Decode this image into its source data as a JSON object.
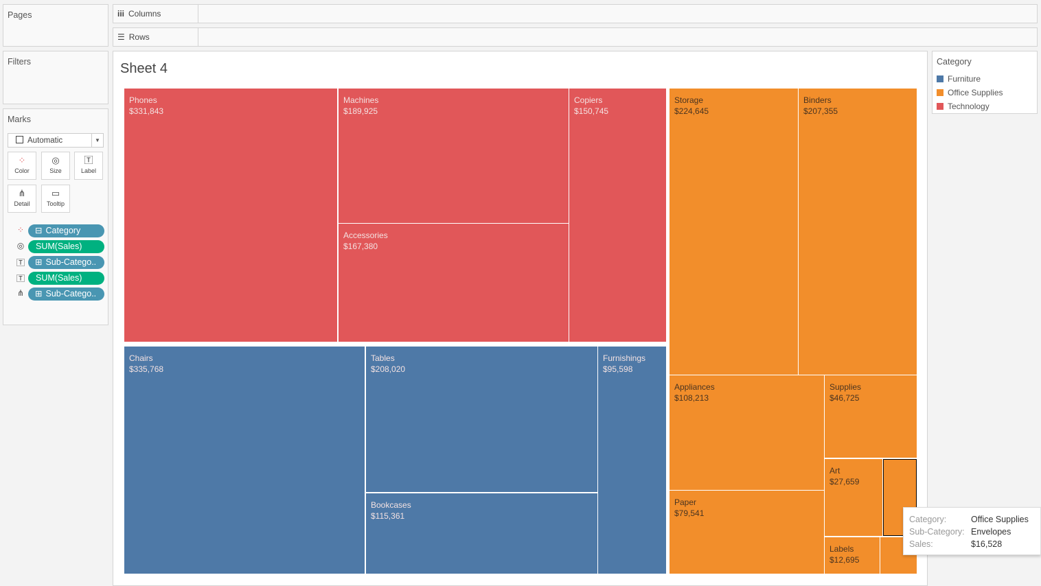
{
  "panels": {
    "pages": "Pages",
    "filters": "Filters",
    "marks": "Marks"
  },
  "shelves": {
    "columns": "Columns",
    "rows": "Rows"
  },
  "marks": {
    "type": "Automatic",
    "buttons": [
      "Color",
      "Size",
      "Label",
      "Detail",
      "Tooltip"
    ],
    "pills": [
      {
        "label": "Category",
        "kind": "dimension",
        "prefix": "⊟",
        "icon": "color-icon"
      },
      {
        "label": "SUM(Sales)",
        "kind": "measure",
        "prefix": "",
        "icon": "size-icon"
      },
      {
        "label": "Sub-Catego..",
        "kind": "dimension",
        "prefix": "⊞",
        "icon": "label-icon"
      },
      {
        "label": "SUM(Sales)",
        "kind": "measure",
        "prefix": "",
        "icon": "label-icon"
      },
      {
        "label": "Sub-Catego..",
        "kind": "dimension",
        "prefix": "⊞",
        "icon": "detail-icon"
      }
    ]
  },
  "sheet_title": "Sheet 4",
  "colors": {
    "Furniture": "#4e79a7",
    "Office Supplies": "#f28e2b",
    "Technology": "#e15759"
  },
  "legend": {
    "title": "Category",
    "items": [
      "Furniture",
      "Office Supplies",
      "Technology"
    ]
  },
  "tiles": [
    {
      "name": "Phones",
      "value": "$331,843",
      "cat": "Technology"
    },
    {
      "name": "Machines",
      "value": "$189,925",
      "cat": "Technology"
    },
    {
      "name": "Accessories",
      "value": "$167,380",
      "cat": "Technology"
    },
    {
      "name": "Copiers",
      "value": "$150,745",
      "cat": "Technology"
    },
    {
      "name": "Chairs",
      "value": "$335,768",
      "cat": "Furniture"
    },
    {
      "name": "Tables",
      "value": "$208,020",
      "cat": "Furniture"
    },
    {
      "name": "Bookcases",
      "value": "$115,361",
      "cat": "Furniture"
    },
    {
      "name": "Furnishings",
      "value": "$95,598",
      "cat": "Furniture"
    },
    {
      "name": "Storage",
      "value": "$224,645",
      "cat": "Office Supplies"
    },
    {
      "name": "Binders",
      "value": "$207,355",
      "cat": "Office Supplies"
    },
    {
      "name": "Appliances",
      "value": "$108,213",
      "cat": "Office Supplies"
    },
    {
      "name": "Paper",
      "value": "$79,541",
      "cat": "Office Supplies"
    },
    {
      "name": "Supplies",
      "value": "$46,725",
      "cat": "Office Supplies"
    },
    {
      "name": "Art",
      "value": "$27,659",
      "cat": "Office Supplies"
    },
    {
      "name": "",
      "value": "",
      "cat": "Office Supplies",
      "selected": true
    },
    {
      "name": "Labels",
      "value": "$12,695",
      "cat": "Office Supplies"
    },
    {
      "name": "",
      "value": "",
      "cat": "Office Supplies"
    }
  ],
  "tooltip": {
    "rows": [
      {
        "k": "Category:",
        "v": "Office Supplies"
      },
      {
        "k": "Sub-Category:",
        "v": "Envelopes"
      },
      {
        "k": "Sales:",
        "v": "$16,528"
      }
    ]
  }
}
